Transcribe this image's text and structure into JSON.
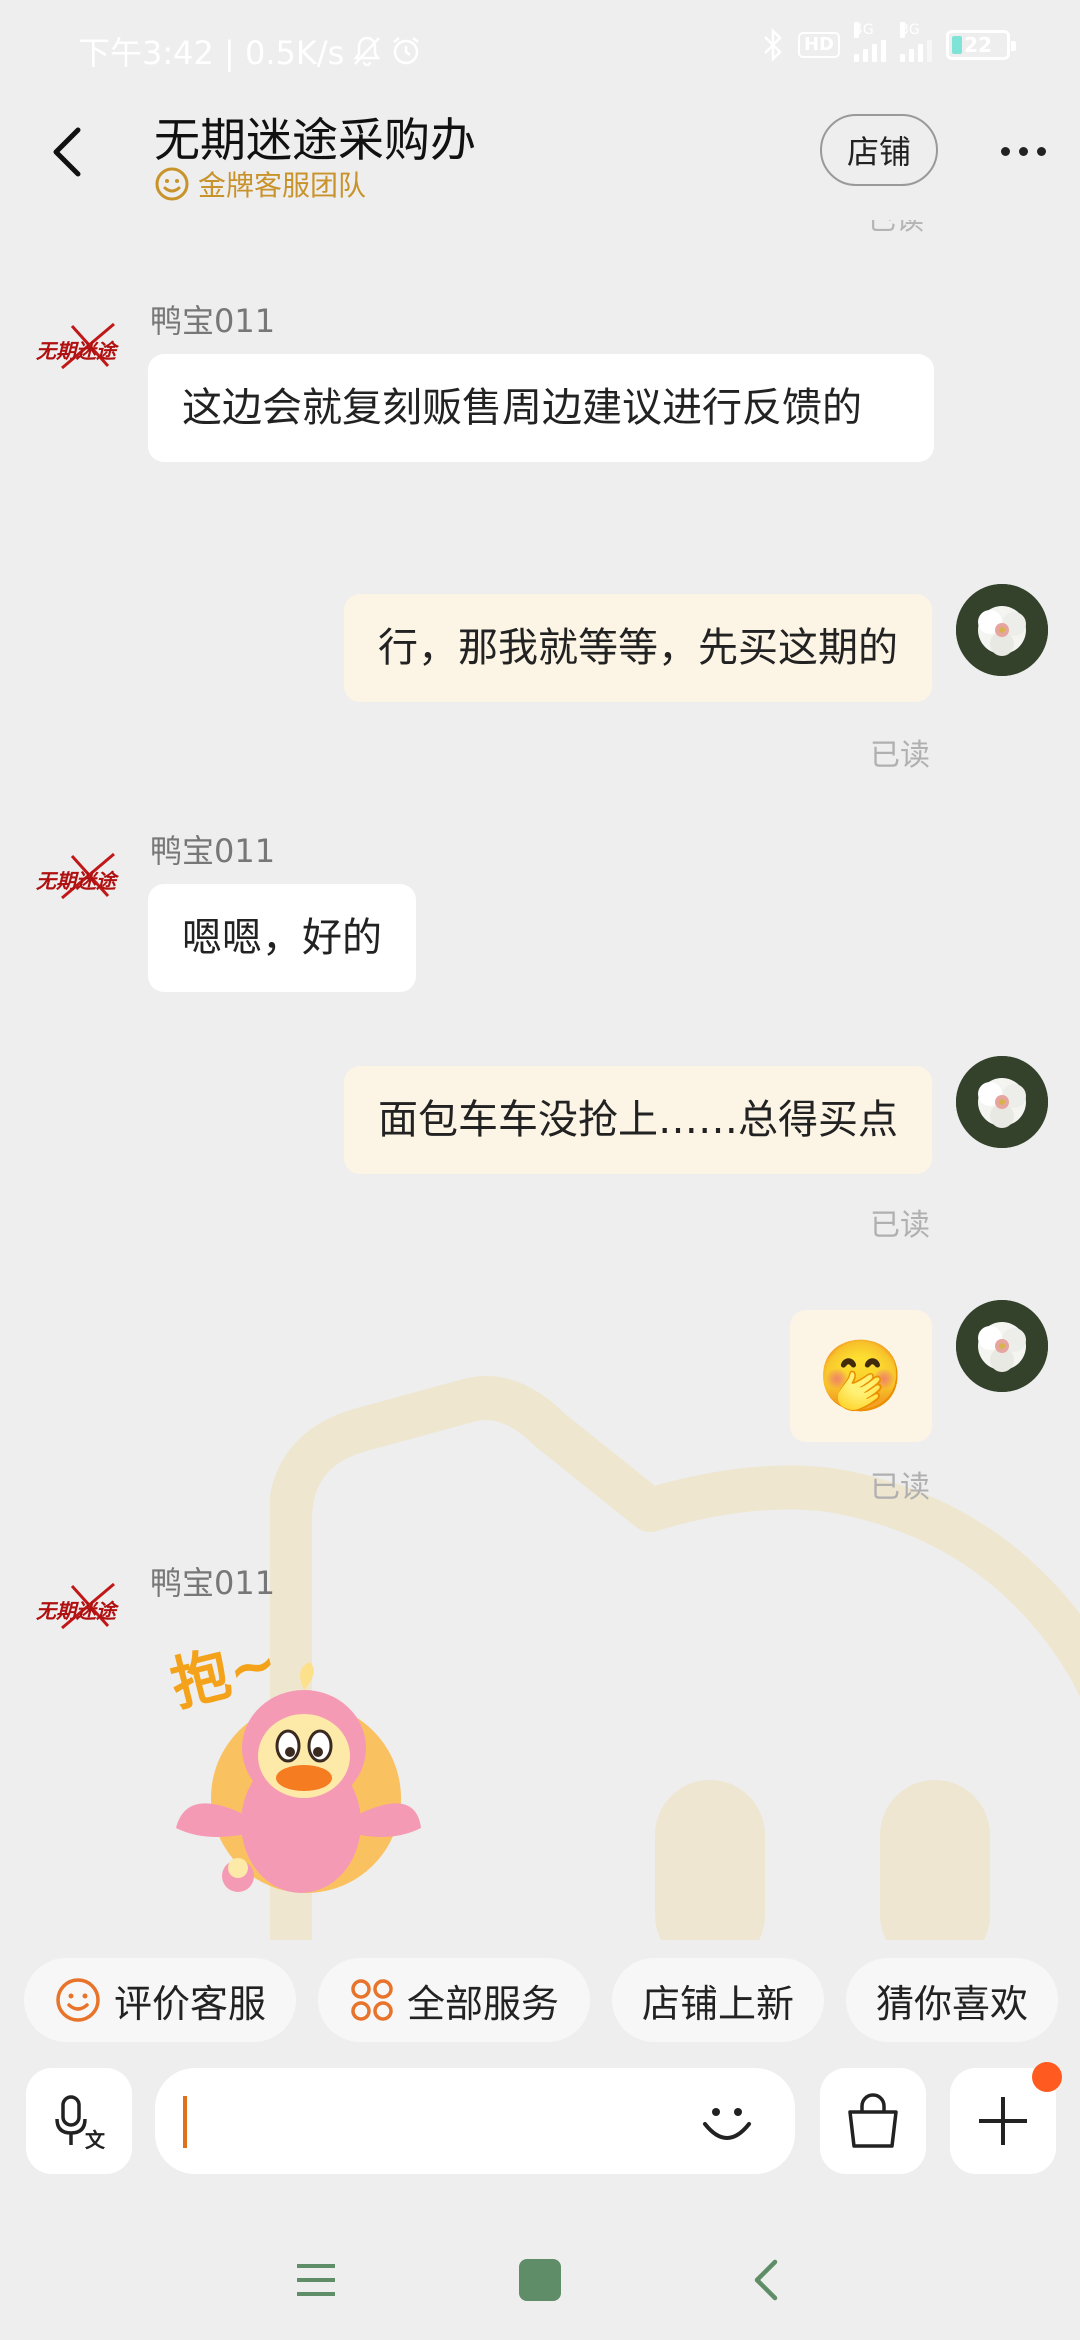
{
  "status_bar": {
    "time_and_speed": "下午3:42 | 0.5K/s",
    "hd": "HD",
    "net1": "4G",
    "net2": "3G",
    "battery": "22"
  },
  "header": {
    "title": "无期迷途采购办",
    "subtitle": "金牌客服团队",
    "shop_button": "店铺"
  },
  "chat": {
    "read_cut": "已读",
    "messages": [
      {
        "sender": "鸭宝011",
        "text": "这边会就复刻贩售周边建议进行反馈的"
      },
      {
        "text": "行，那我就等等，先买这期的",
        "read": "已读"
      },
      {
        "sender": "鸭宝011",
        "text": "嗯嗯，好的"
      },
      {
        "text": "面包车车没抢上……总得买点",
        "read": "已读"
      },
      {
        "emoji": "🤭",
        "read": "已读"
      },
      {
        "sender": "鸭宝011",
        "sticker_text": "抱~"
      }
    ],
    "shop_logo_text": "无期迷途"
  },
  "quick_actions": [
    {
      "label": "评价客服",
      "icon": "smile-icon"
    },
    {
      "label": "全部服务",
      "icon": "grid-icon"
    },
    {
      "label": "店铺上新"
    },
    {
      "label": "猜你喜欢"
    }
  ],
  "input_bar": {
    "voice_icon_char": "文"
  },
  "colors": {
    "accent": "#e0701a",
    "gold": "#c9932b",
    "bubble_out": "#fcf5e6",
    "badge": "#ff5a1f"
  }
}
